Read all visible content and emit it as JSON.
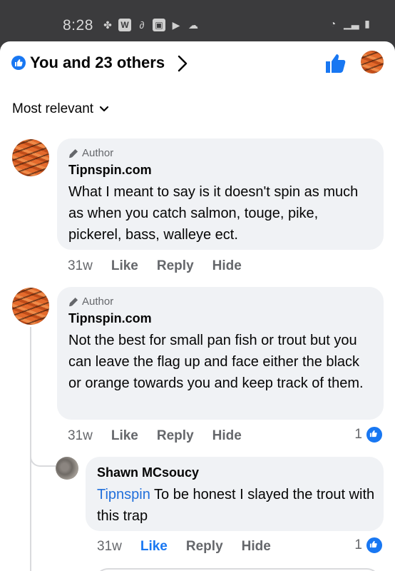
{
  "status_bar": {
    "time": "8:28",
    "left_icons": [
      "fan-icon",
      "w-app-icon",
      "loop-icon",
      "gallery-icon",
      "youtube-icon",
      "cloud-icon"
    ],
    "right_icons": [
      "wifi-icon",
      "signal-icon",
      "battery-icon"
    ]
  },
  "reactions": {
    "summary": "You and 23 others",
    "icon": "thumbs-up-icon"
  },
  "sort": {
    "label": "Most relevant"
  },
  "comments": [
    {
      "badge": "Author",
      "name": "Tipnspin.com",
      "text": "What I meant to say is it doesn't spin as much as when you catch salmon, touge, pike, pickerel, bass, walleye ect.",
      "time": "31w",
      "actions": [
        "Like",
        "Reply",
        "Hide"
      ]
    },
    {
      "badge": "Author",
      "name": "Tipnspin.com",
      "text": "Not the best for small pan fish or trout but you can leave the flag up and face either the black or orange towards you and keep track of them.",
      "time": "31w",
      "actions": [
        "Like",
        "Reply",
        "Hide"
      ],
      "reaction_count": "1"
    }
  ],
  "reply": {
    "name": "Shawn MCsoucy",
    "mention": "Tipnspin",
    "text": " To be honest I slayed the trout with this trap",
    "time": "31w",
    "actions": [
      "Like",
      "Reply",
      "Hide"
    ],
    "liked": true,
    "reaction_count": "1"
  },
  "colors": {
    "accent": "#1877f2",
    "bubble": "#f0f2f5",
    "meta_text": "#65676b",
    "status_bar": "#3b3b3d"
  }
}
